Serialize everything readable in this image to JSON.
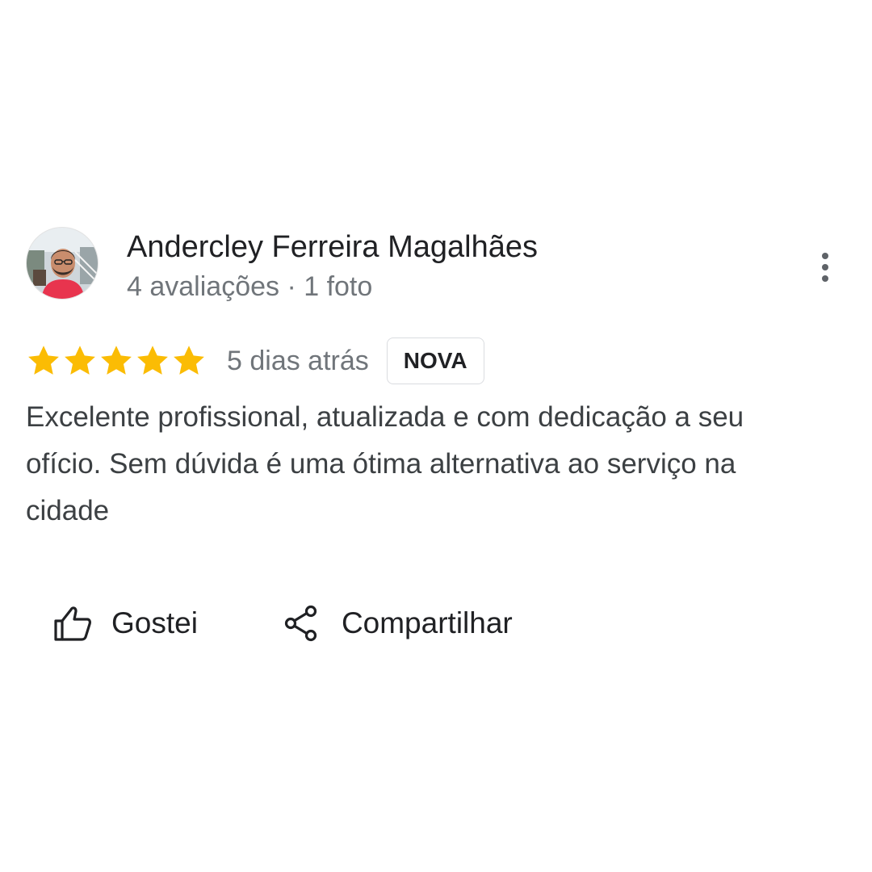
{
  "review": {
    "reviewer": {
      "name": "Andercley Ferreira Magalhães",
      "meta": "4 avaliações · 1 foto",
      "avatar_icon": "person-photo"
    },
    "rating": 5,
    "rating_max": 5,
    "star_color": "#fbbc04",
    "date": "5 dias atrás",
    "badge": "NOVA",
    "text": "Excelente profissional, atualizada e com dedicação a seu ofício. Sem dúvida é uma ótima alternativa ao serviço na cidade",
    "menu_icon": "more-vert-icon"
  },
  "actions": {
    "like_label": "Gostei",
    "like_icon": "thumbs-up-icon",
    "share_label": "Compartilhar",
    "share_icon": "share-icon"
  }
}
